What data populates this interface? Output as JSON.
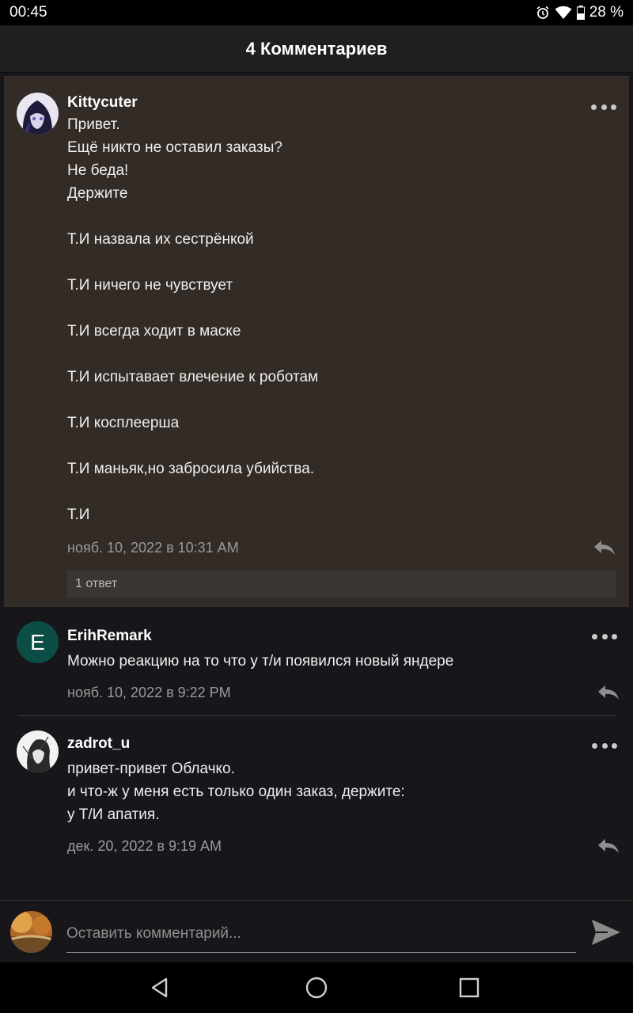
{
  "status_bar": {
    "time": "00:45",
    "battery": "28 %",
    "icons": [
      "alarm-icon",
      "wifi-icon",
      "battery-icon"
    ]
  },
  "header": {
    "title": "4 Комментариев"
  },
  "comments": [
    {
      "username": "Kittycuter",
      "avatar": "anime-avatar",
      "lines": [
        "Привет.",
        "Ещё никто не оставил заказы?",
        "Не беда!",
        "Держите",
        "",
        "Т.И назвала их сестрёнкой",
        "",
        "Т.И ничего не чувствует",
        "",
        "Т.И всегда ходит в маске",
        "",
        "Т.И испытавает влечение к роботам",
        "",
        "Т.И косплеерша",
        "",
        "Т.И маньяк,но забросила убийства.",
        "",
        "Т.И"
      ],
      "date": "нояб. 10, 2022 в 10:31 AM",
      "replies_label": "1 ответ"
    },
    {
      "username": "ErihRemark",
      "avatar_letter": "E",
      "avatar_color": "#0c4d46",
      "lines": [
        "Можно реакцию на то что у т/и появился новый яндере"
      ],
      "date": "нояб. 10, 2022 в 9:22 PM"
    },
    {
      "username": "zadrot_u",
      "avatar": "sketch-avatar",
      "lines": [
        "привет-привет Облачко.",
        "и что-ж у меня есть только один заказ, держите:",
        "у Т/И апатия."
      ],
      "date": "дек. 20, 2022 в 9:19 AM"
    }
  ],
  "composer": {
    "placeholder": "Оставить комментарий...",
    "send_icon": "send-icon"
  },
  "colors": {
    "highlight_bg": "#322b26",
    "background": "#17161a",
    "header_bg": "#1f1f22"
  }
}
